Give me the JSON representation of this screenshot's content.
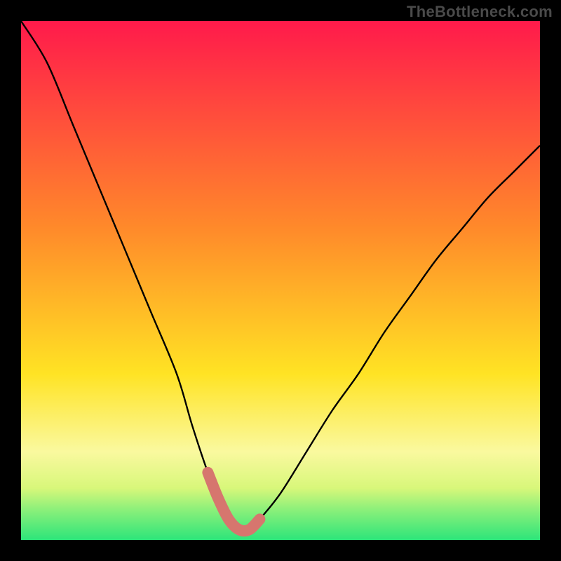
{
  "watermark": "TheBottleneck.com",
  "chart_data": {
    "type": "line",
    "title": "",
    "xlabel": "",
    "ylabel": "",
    "xlim": [
      0,
      100
    ],
    "ylim": [
      0,
      100
    ],
    "grid": false,
    "series": [
      {
        "name": "bottleneck-curve",
        "x": [
          0,
          5,
          10,
          15,
          20,
          25,
          30,
          33,
          36,
          38,
          40,
          42,
          44,
          46,
          50,
          55,
          60,
          65,
          70,
          75,
          80,
          85,
          90,
          95,
          100
        ],
        "y": [
          100,
          92,
          80,
          68,
          56,
          44,
          32,
          22,
          13,
          8,
          4,
          2,
          2,
          4,
          9,
          17,
          25,
          32,
          40,
          47,
          54,
          60,
          66,
          71,
          76
        ],
        "color": "#000000"
      },
      {
        "name": "optimal-highlight",
        "x": [
          36,
          38,
          40,
          42,
          44,
          46
        ],
        "y": [
          13,
          8,
          4,
          2,
          2,
          4
        ],
        "color": "#d6766e"
      }
    ],
    "background": {
      "type": "vertical-gradient",
      "stops": [
        {
          "offset": 0,
          "color": "#ff1a4b"
        },
        {
          "offset": 40,
          "color": "#ff8a2a"
        },
        {
          "offset": 68,
          "color": "#ffe324"
        },
        {
          "offset": 83,
          "color": "#faf99f"
        },
        {
          "offset": 90,
          "color": "#d8f77a"
        },
        {
          "offset": 94,
          "color": "#8ef07a"
        },
        {
          "offset": 100,
          "color": "#2de57a"
        }
      ]
    }
  }
}
